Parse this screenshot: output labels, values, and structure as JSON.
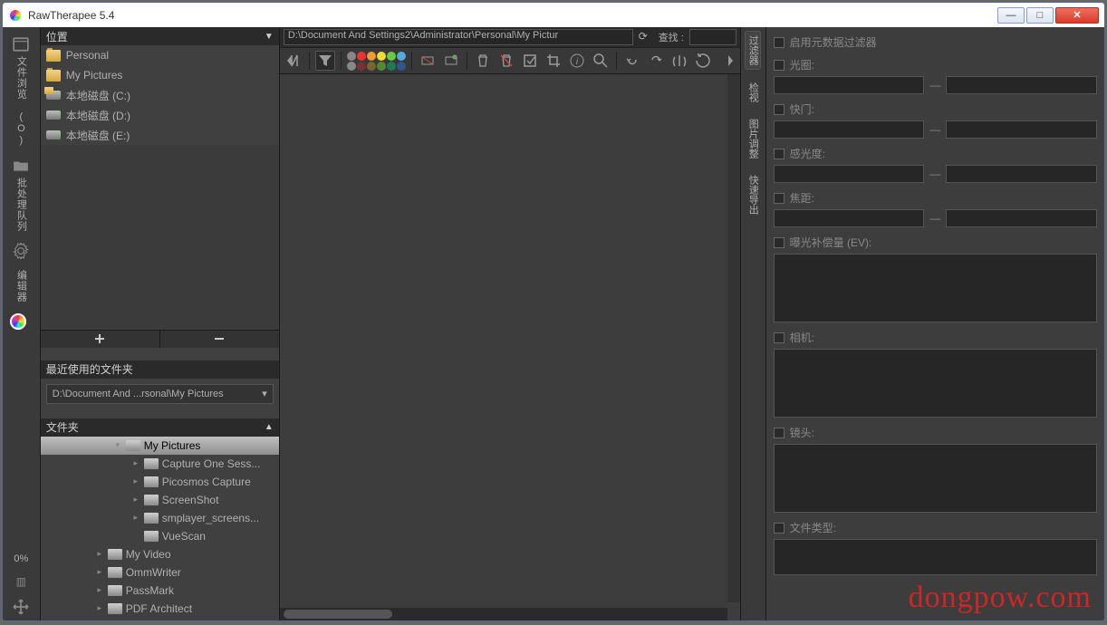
{
  "title": "RawTherapee 5.4",
  "mode_tabs": [
    {
      "label": "文件浏览 (O)",
      "icon": "window-icon"
    },
    {
      "label": "批处理队列",
      "icon": "folder-icon"
    },
    {
      "label": "",
      "icon": "gear-icon"
    },
    {
      "label": "编辑器",
      "icon": "logo-icon"
    }
  ],
  "side_bottom_percent": "0%",
  "locations_header": "位置",
  "locations": [
    {
      "label": "Personal",
      "type": "folder"
    },
    {
      "label": "My Pictures",
      "type": "folder"
    },
    {
      "label": "本地磁盘 (C:)",
      "type": "drive",
      "tag": true
    },
    {
      "label": "本地磁盘 (D:)",
      "type": "drive"
    },
    {
      "label": "本地磁盘 (E:)",
      "type": "drive"
    }
  ],
  "recent_header": "最近使用的文件夹",
  "recent_value": "D:\\Document And ...rsonal\\My Pictures",
  "tree_header": "文件夹",
  "tree": [
    {
      "label": "My Pictures",
      "depth": 0,
      "selected": true,
      "expander": "▾"
    },
    {
      "label": "Capture One Sess...",
      "depth": 1,
      "expander": "▸"
    },
    {
      "label": "Picosmos Capture",
      "depth": 1,
      "expander": "▸"
    },
    {
      "label": "ScreenShot",
      "depth": 1,
      "expander": "▸"
    },
    {
      "label": "smplayer_screens...",
      "depth": 1,
      "expander": "▸"
    },
    {
      "label": "VueScan",
      "depth": 1,
      "expander": ""
    },
    {
      "label": "My Video",
      "depth": -1,
      "expander": "▸"
    },
    {
      "label": "OmmWriter",
      "depth": -1,
      "expander": "▸"
    },
    {
      "label": "PassMark",
      "depth": -1,
      "expander": "▸"
    },
    {
      "label": "PDF Architect",
      "depth": -1,
      "expander": "▸"
    }
  ],
  "path_value": "D:\\Document And Settings2\\Administrator\\Personal\\My Pictur",
  "find_label": "查找 :",
  "swatches": [
    "#888",
    "#e33",
    "#e93",
    "#ed3",
    "#6c4",
    "#5ad",
    "#888",
    "#733",
    "#763",
    "#583",
    "#275",
    "#358"
  ],
  "right_tabs": [
    "过滤器",
    "检视",
    "图片调整",
    "快速导出"
  ],
  "filter_enable": "启用元数据过滤器",
  "ranges": [
    {
      "label": "光圈:"
    },
    {
      "label": "快门:"
    },
    {
      "label": "感光度:"
    },
    {
      "label": "焦距:"
    }
  ],
  "ev_label": "曝光补偿量 (EV):",
  "camera_label": "相机:",
  "lens_label": "镜头:",
  "filetype_label": "文件类型:",
  "watermark": "dongpow.com"
}
